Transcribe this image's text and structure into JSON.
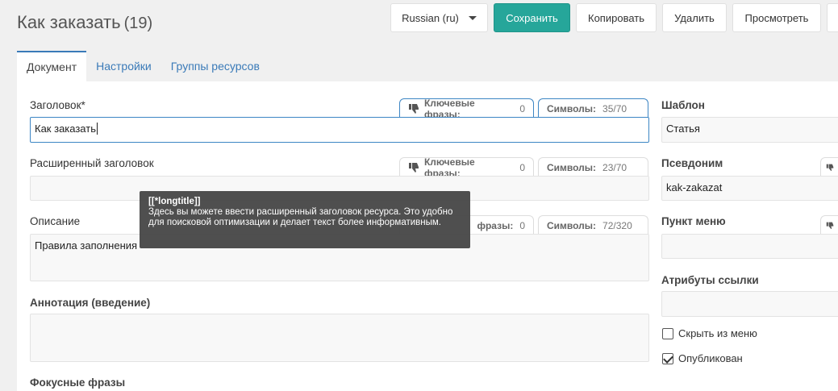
{
  "page": {
    "title": "Как заказать",
    "count": "(19)"
  },
  "toolbar": {
    "language": "Russian (ru)",
    "save": "Сохранить",
    "copy": "Копировать",
    "delete": "Удалить",
    "view": "Просмотреть"
  },
  "tabs": [
    "Документ",
    "Настройки",
    "Группы ресурсов"
  ],
  "fields": {
    "title": {
      "label": "Заголовок*",
      "value": "Как заказать",
      "keywords_label": "Ключевые фразы:",
      "keywords_count": "0",
      "symbols_label": "Символы:",
      "symbols_count": "35/70"
    },
    "longtitle": {
      "label": "Расширенный заголовок",
      "value": "",
      "keywords_label": "Ключевые фразы:",
      "keywords_count": "0",
      "symbols_label": "Символы:",
      "symbols_count": "23/70"
    },
    "description": {
      "label": "Описание",
      "value": "Правила заполнения",
      "keywords_label": "фразы:",
      "keywords_count": "0",
      "symbols_label": "Символы:",
      "symbols_count": "72/320"
    },
    "introtext": {
      "label": "Аннотация (введение)",
      "value": ""
    },
    "focus": {
      "label": "Фокусные фразы"
    }
  },
  "tooltip": {
    "title": "[[*longtitle]]",
    "text": "Здесь вы можете ввести расширенный заголовок ресурса. Это удобно для поисковой оптимизации и делает текст более информативным."
  },
  "sidebar": {
    "template_label": "Шаблон",
    "template_value": "Статья",
    "alias_label": "Псевдоним",
    "alias_value": "kak-zakazat",
    "menu_label": "Пункт меню",
    "menu_value": "",
    "link_attr_label": "Атрибуты ссылки",
    "link_attr_value": "",
    "hide_menu": "Скрыть из меню",
    "published": "Опубликован"
  },
  "colors": {
    "primary": "#26a69a",
    "accent": "#3d86c4",
    "tooltip_bg": "#464646"
  }
}
